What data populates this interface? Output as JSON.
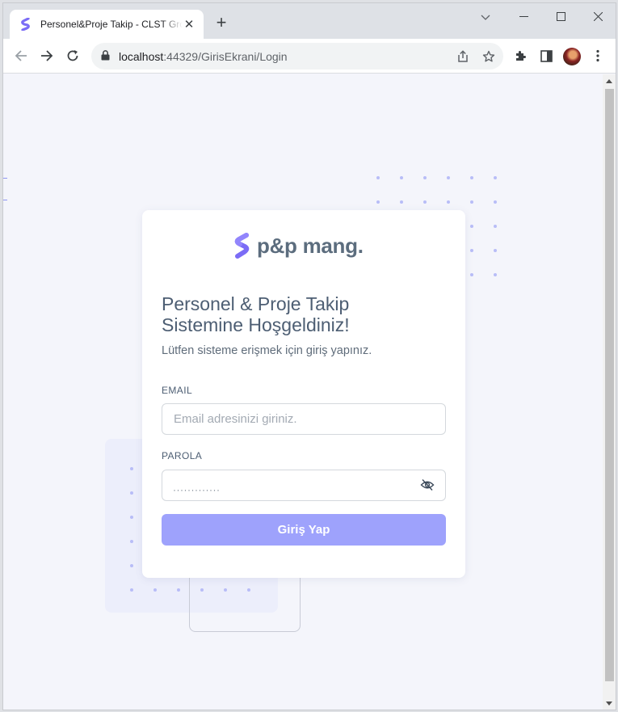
{
  "browser": {
    "tab_title": "Personel&Proje Takip - CLST Group",
    "url_host": "localhost",
    "url_path": ":44329/GirisEkrani/Login"
  },
  "page": {
    "brand_name": "p&p mang.",
    "welcome_line1": "Personel & Proje Takip",
    "welcome_line2": "Sistemine Hoşgeldiniz!",
    "subtitle": "Lütfen sisteme erişmek için giriş yapınız.",
    "email_label": "EMAIL",
    "email_placeholder": "Email adresinizi giriniz.",
    "email_value": "",
    "password_label": "PAROLA",
    "password_mask": "·············",
    "submit_label": "Giriş Yap"
  },
  "colors": {
    "accent": "#9ea2fc",
    "logo": "#7b6cf6",
    "text": "#4d5e73"
  }
}
